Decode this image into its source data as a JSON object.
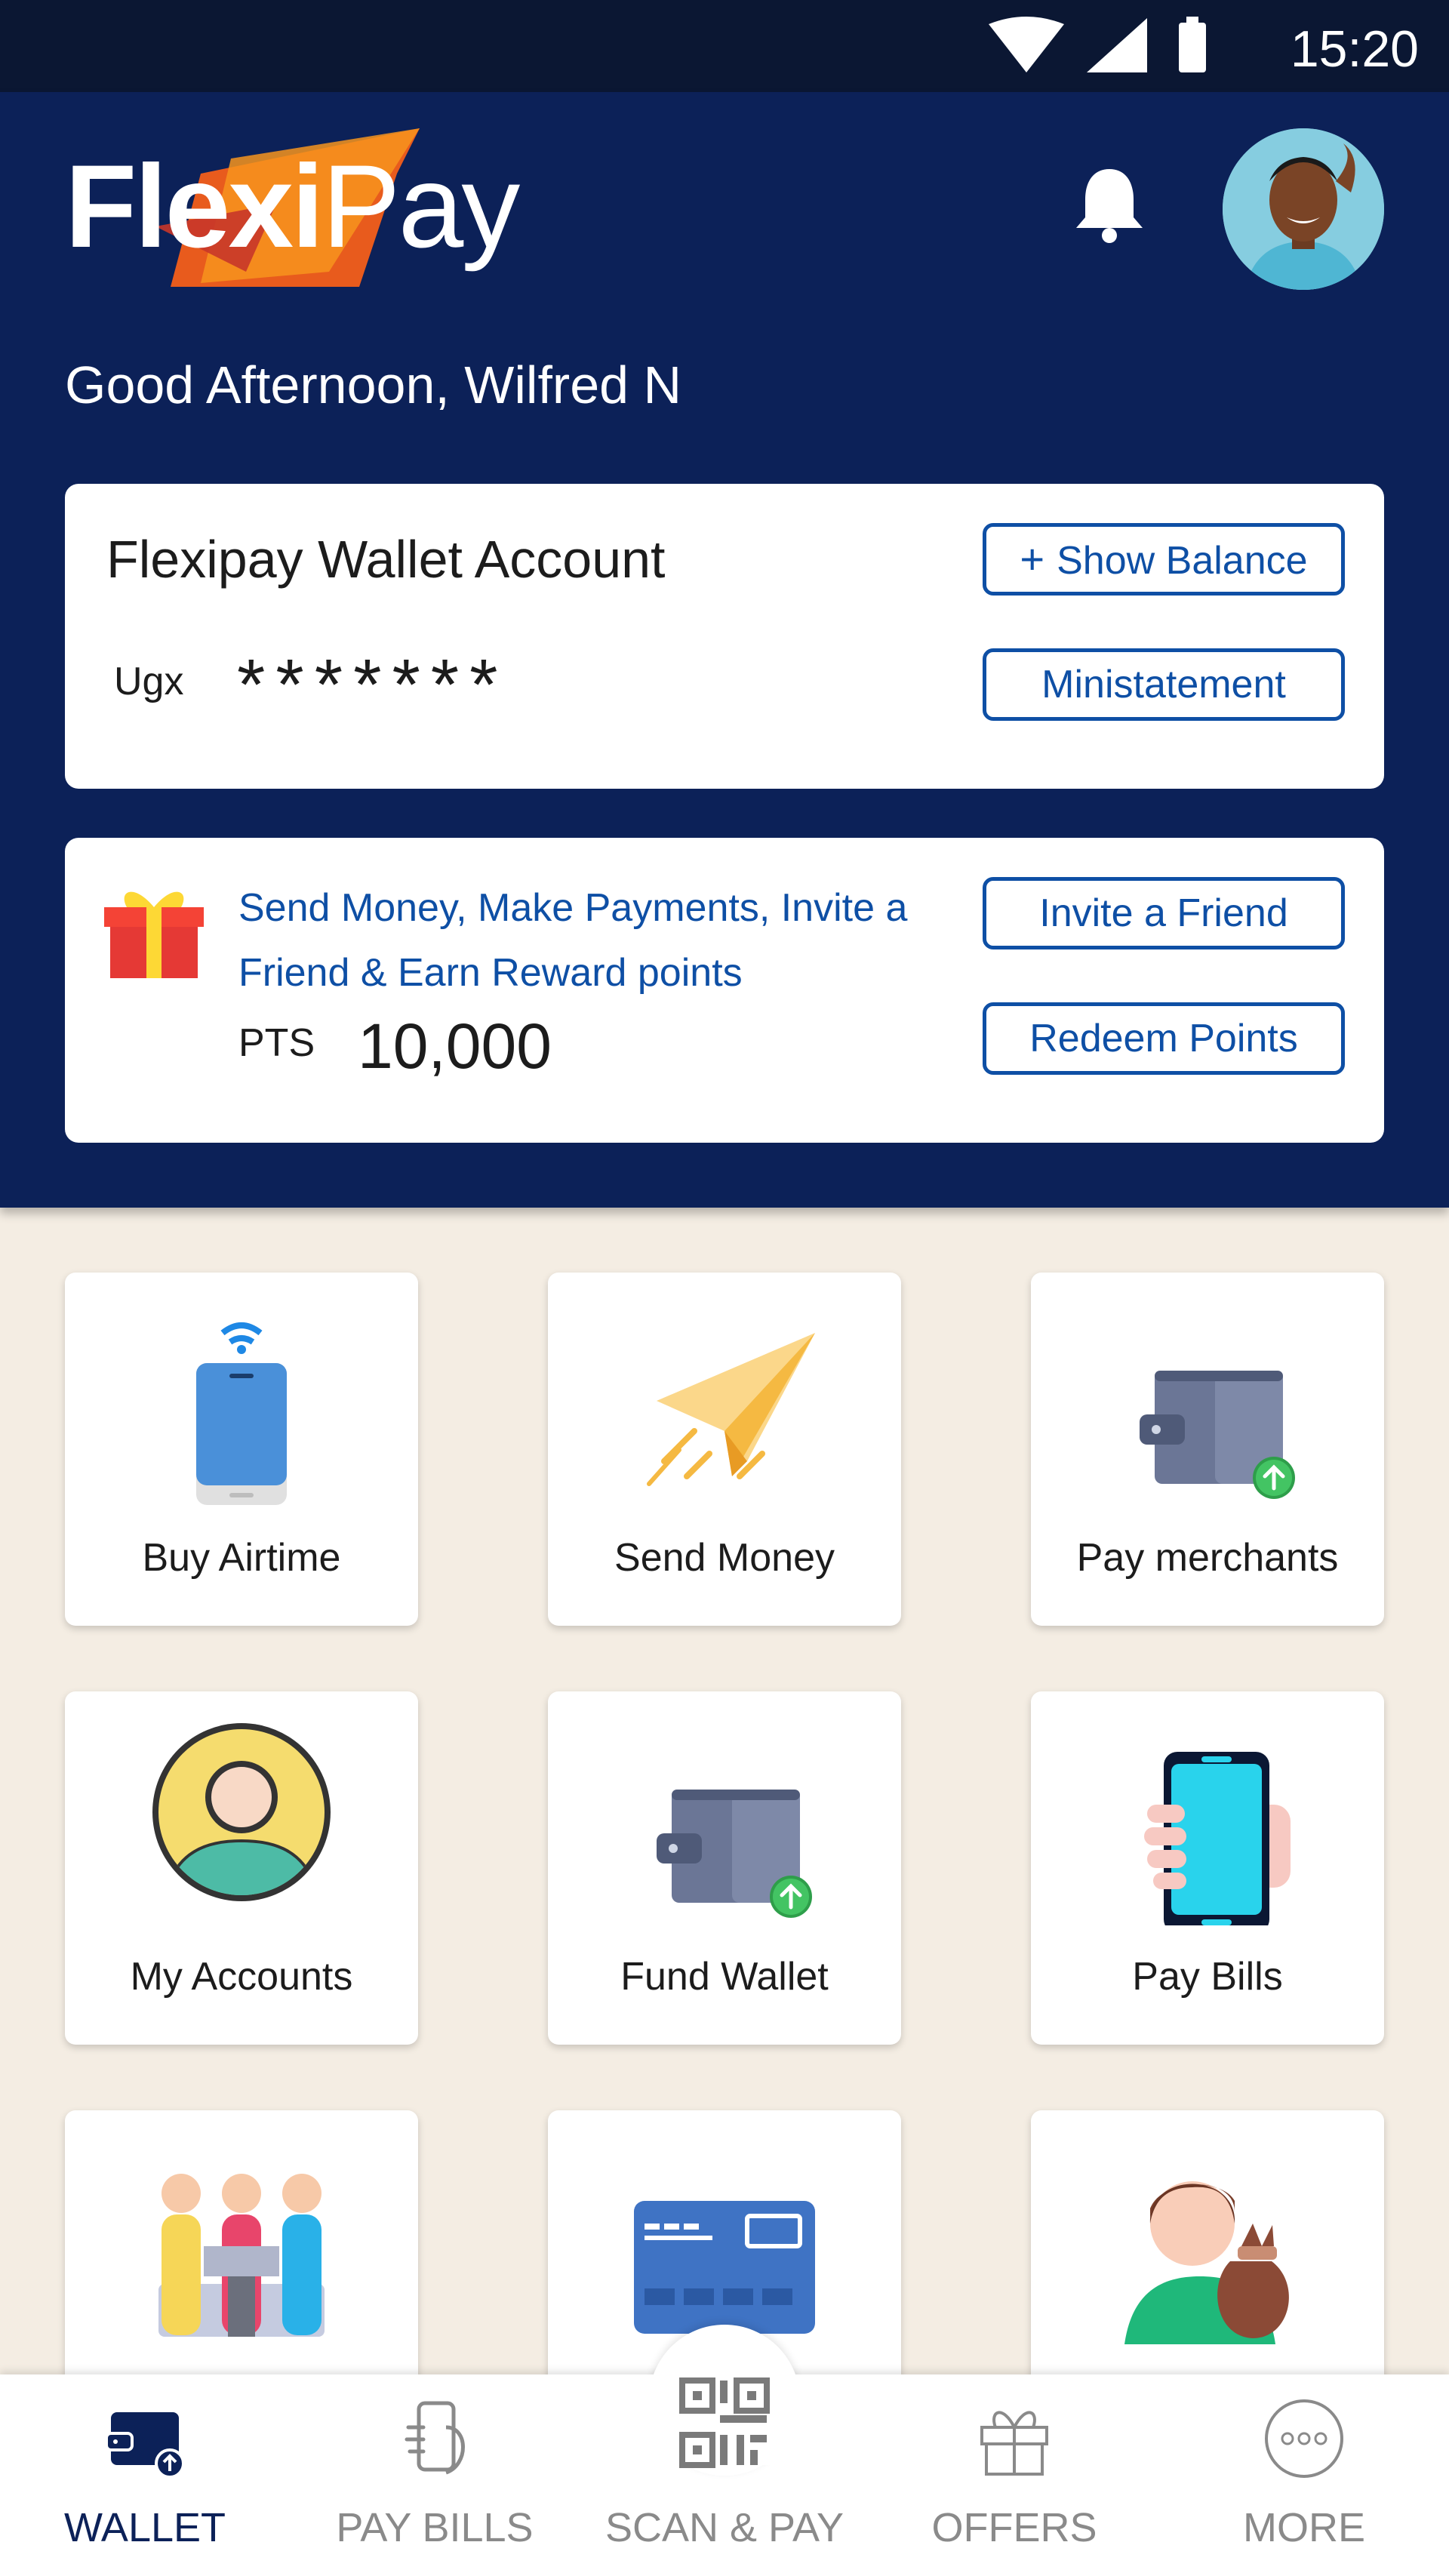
{
  "status_bar": {
    "time": "15:20",
    "icons": [
      "wifi-icon",
      "signal-icon",
      "battery-icon"
    ]
  },
  "header": {
    "logo": {
      "part_bold": "Flexi",
      "part_light": "Pay"
    },
    "greeting": "Good Afternoon, Wilfred N"
  },
  "wallet_card": {
    "title": "Flexipay Wallet Account",
    "currency": "Ugx",
    "masked_balance": "*******",
    "show_balance_label": "Show Balance",
    "ministatement_label": "Ministatement"
  },
  "rewards_card": {
    "text": "Send Money, Make Payments, Invite a Friend & Earn Reward points",
    "points_label": "PTS",
    "points_value": "10,000",
    "invite_label": "Invite a Friend",
    "redeem_label": "Redeem Points"
  },
  "tiles": [
    {
      "label": "Buy Airtime",
      "icon": "phone-wifi-icon"
    },
    {
      "label": "Send Money",
      "icon": "paper-plane-icon"
    },
    {
      "label": "Pay merchants",
      "icon": "wallet-upload-icon"
    },
    {
      "label": "My Accounts",
      "icon": "user-account-icon"
    },
    {
      "label": "Fund Wallet",
      "icon": "wallet-upload-icon"
    },
    {
      "label": "Pay Bills",
      "icon": "hand-phone-icon"
    },
    {
      "label": "",
      "icon": "group-people-icon"
    },
    {
      "label": "",
      "icon": "credit-card-icon"
    },
    {
      "label": "",
      "icon": "person-money-bag-icon"
    }
  ],
  "bottom_nav": [
    {
      "label": "WALLET",
      "icon": "wallet-nav-icon",
      "active": true
    },
    {
      "label": "PAY BILLS",
      "icon": "pay-bills-nav-icon",
      "active": false
    },
    {
      "label": "SCAN & PAY",
      "icon": "qr-code-icon",
      "active": false
    },
    {
      "label": "OFFERS",
      "icon": "gift-nav-icon",
      "active": false
    },
    {
      "label": "MORE",
      "icon": "more-dots-icon",
      "active": false
    }
  ],
  "colors": {
    "header_bg": "#0c2158",
    "accent_blue": "#0e4fa5",
    "page_bg": "#f4ede3"
  }
}
